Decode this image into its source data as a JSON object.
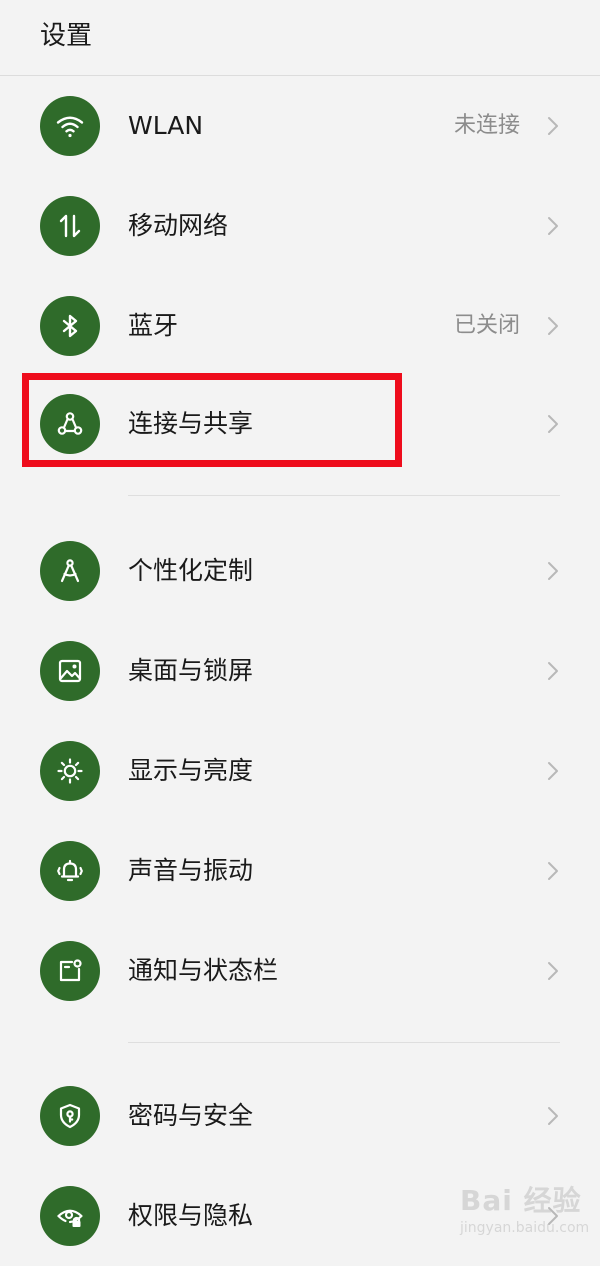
{
  "header": {
    "title": "设置"
  },
  "colors": {
    "icon_bg": "#2f6b2a",
    "highlight": "#ee0c1c",
    "status_text": "#8c8c8c"
  },
  "settings": {
    "wlan": {
      "label": "WLAN",
      "status": "未连接",
      "icon": "wifi-icon"
    },
    "mobile": {
      "label": "移动网络",
      "icon": "mobile-data-icon"
    },
    "bluetooth": {
      "label": "蓝牙",
      "status": "已关闭",
      "icon": "bluetooth-icon"
    },
    "connection": {
      "label": "连接与共享",
      "icon": "share-icon"
    },
    "personalize": {
      "label": "个性化定制",
      "icon": "compass-icon"
    },
    "wallpaper": {
      "label": "桌面与锁屏",
      "icon": "image-icon"
    },
    "display": {
      "label": "显示与亮度",
      "icon": "brightness-icon"
    },
    "sound": {
      "label": "声音与振动",
      "icon": "bell-vibrate-icon"
    },
    "notification": {
      "label": "通知与状态栏",
      "icon": "notification-icon"
    },
    "security": {
      "label": "密码与安全",
      "icon": "shield-key-icon"
    },
    "privacy": {
      "label": "权限与隐私",
      "icon": "eye-lock-icon"
    }
  },
  "watermark": {
    "brand": "Bai 经验",
    "domain": "jingyan.baidu.com"
  }
}
